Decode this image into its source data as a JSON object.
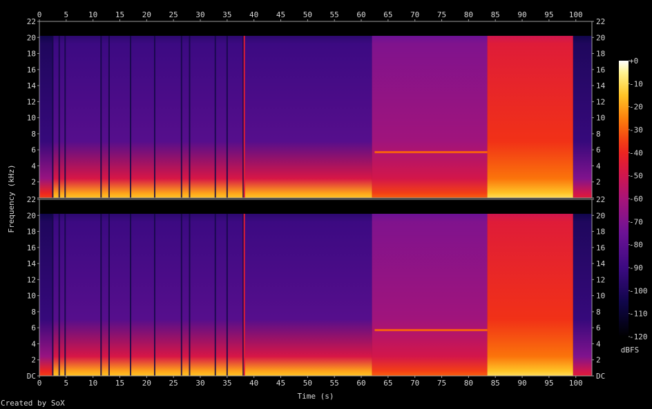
{
  "chart_data": {
    "type": "heatmap",
    "kind": "spectrogram",
    "xlabel": "Time (s)",
    "ylabel": "Frequency (kHz)",
    "x_ticks": [
      0,
      5,
      10,
      15,
      20,
      25,
      30,
      35,
      40,
      45,
      50,
      55,
      60,
      65,
      70,
      75,
      80,
      85,
      90,
      95,
      100
    ],
    "xlim": [
      0,
      103
    ],
    "y_ticks": [
      "DC",
      "2",
      "4",
      "6",
      "8",
      "10",
      "12",
      "14",
      "16",
      "18",
      "20",
      "22"
    ],
    "y_tick_values": [
      0,
      2,
      4,
      6,
      8,
      10,
      12,
      14,
      16,
      18,
      20,
      22
    ],
    "ylim": [
      0,
      22
    ],
    "content_max_khz": 20.2,
    "channels": 2,
    "colorbar": {
      "label": "dBFS",
      "ticks": [
        "+0",
        "-10",
        "-20",
        "-30",
        "-40",
        "-50",
        "-60",
        "-70",
        "-80",
        "-90",
        "-100",
        "-110",
        "-120"
      ],
      "tick_values": [
        0,
        -10,
        -20,
        -30,
        -40,
        -50,
        -60,
        -70,
        -80,
        -90,
        -100,
        -110,
        -120
      ],
      "range": [
        -120,
        0
      ]
    },
    "segments": [
      {
        "start_s": 0.0,
        "end_s": 2.5,
        "level_db": -100,
        "floor_db": -40
      },
      {
        "start_s": 2.5,
        "end_s": 62.0,
        "level_db": -90,
        "floor_db": -20
      },
      {
        "start_s": 62.0,
        "end_s": 83.5,
        "level_db": -70,
        "floor_db": -35
      },
      {
        "start_s": 83.5,
        "end_s": 99.5,
        "level_db": -45,
        "floor_db": -15
      },
      {
        "start_s": 99.5,
        "end_s": 103.0,
        "level_db": -100,
        "floor_db": -50
      }
    ],
    "tone_lines": [
      {
        "start_s": 62.5,
        "end_s": 83.5,
        "freq_khz": 5.7,
        "level_db": -30
      }
    ],
    "dark_gaps_s": [
      2.5,
      3.7,
      4.8,
      11.5,
      13.0,
      17.0,
      21.5,
      26.5,
      28.0,
      32.8,
      35.0,
      38.0
    ],
    "transient_peaks_s": [
      38.2
    ]
  },
  "credit": "Created by SoX"
}
